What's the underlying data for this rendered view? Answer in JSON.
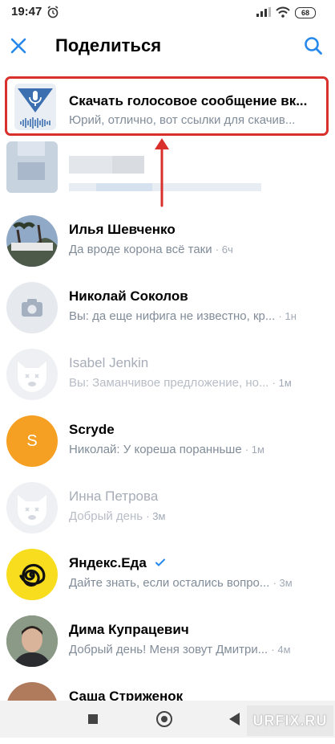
{
  "status_bar": {
    "time": "19:47",
    "battery": "68"
  },
  "header": {
    "title": "Поделиться"
  },
  "highlighted_chat": {
    "name": "Скачать голосовое сообщение вк...",
    "message": "Юрий, отлично, вот ссылки для скачив..."
  },
  "chats": [
    {
      "name": "Илья Шевченко",
      "message": "Да вроде корона всё таки",
      "time": "6ч"
    },
    {
      "name": "Николай Соколов",
      "message": "Вы: да еще нифига не известно, кр...",
      "time": "1н"
    },
    {
      "name": "Isabel Jenkin",
      "message": "Вы: Заманчивое предложение, но...",
      "time": "1м"
    },
    {
      "name": "Scryde",
      "avatar_letter": "S",
      "message": "Николай: У кореша поранньше",
      "time": "1м"
    },
    {
      "name": "Инна Петрова",
      "message": "Добрый день",
      "time": "3м"
    },
    {
      "name": "Яндекс.Еда",
      "message": "Дайте знать, если остались вопро...",
      "time": "3м"
    },
    {
      "name": "Дима Купрацевич",
      "message": "Добрый день! Меня зовут Дмитри...",
      "time": "4м"
    },
    {
      "name": "Саша Стриженок"
    }
  ],
  "watermark": "URFIX.RU",
  "colors": {
    "accent": "#2688eb",
    "highlight": "#d9302c",
    "scryde": "#f5a023"
  }
}
